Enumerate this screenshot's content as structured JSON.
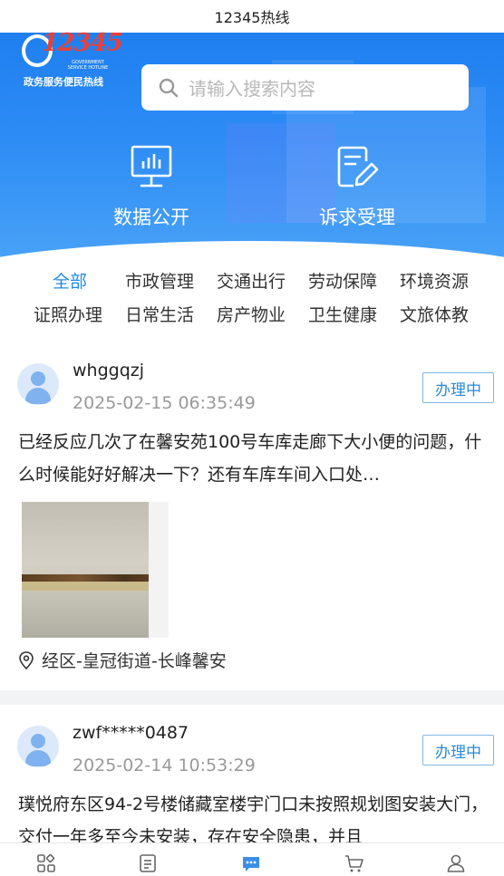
{
  "status_title": "12345热线",
  "logo": {
    "number": "12345",
    "english": "GOVERNMENT SERVICE HOTLINE",
    "chinese": "政务服务便民热线"
  },
  "search": {
    "placeholder": "请输入搜索内容",
    "icon": "search-icon"
  },
  "entries": [
    {
      "label": "数据公开",
      "icon": "monitor-chart-icon"
    },
    {
      "label": "诉求受理",
      "icon": "document-edit-icon"
    }
  ],
  "categories": {
    "row1": [
      "全部",
      "市政管理",
      "交通出行",
      "劳动保障",
      "环境资源"
    ],
    "row2": [
      "证照办理",
      "日常生活",
      "房产物业",
      "卫生健康",
      "文旅体教"
    ],
    "active": "全部",
    "active_color": "#1f8be8"
  },
  "posts": [
    {
      "user": "whggqzj",
      "time": "2025-02-15 06:35:49",
      "status": "办理中",
      "content": "已经反应几次了在馨安苑100号车库走廊下大小便的问题，什么时候能好好解决一下？还有车库车间入口处…",
      "location": "经区-皇冠街道-长峰馨安"
    },
    {
      "user": "zwf*****0487",
      "time": "2025-02-14 10:53:29",
      "status": "办理中",
      "content": "璞悦府东区94-2号楼储藏室楼宇门口未按照规划图安装大门，交付一年多至今未安装，存在安全隐患，并且"
    }
  ],
  "tabbar": [
    "grid-icon",
    "list-icon",
    "chat-icon",
    "cart-icon",
    "user-icon"
  ],
  "colors": {
    "brand_blue": "#1f7ff0",
    "status_blue": "#2a8ad8"
  }
}
